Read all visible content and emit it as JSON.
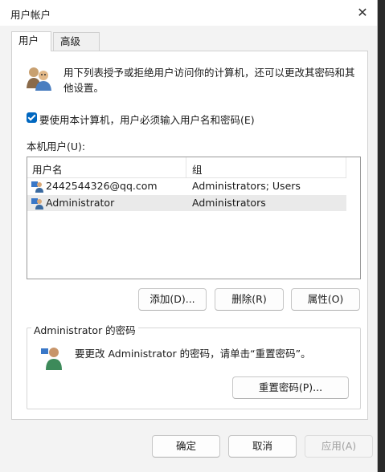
{
  "window": {
    "title": "用户帐户"
  },
  "tabs": [
    {
      "label": "用户"
    },
    {
      "label": "高级"
    }
  ],
  "intro": "用下列表授予或拒绝用户访问你的计算机，还可以更改其密码和其他设置。",
  "require_login": {
    "label": "要使用本计算机，用户必须输入用户名和密码(E)",
    "checked": true
  },
  "users_list": {
    "label": "本机用户(U):",
    "columns": [
      "用户名",
      "组"
    ],
    "rows": [
      {
        "name": "2442544326@qq.com",
        "group": "Administrators; Users",
        "selected": false
      },
      {
        "name": "Administrator",
        "group": "Administrators",
        "selected": true
      }
    ]
  },
  "list_buttons": {
    "add": "添加(D)...",
    "remove": "删除(R)",
    "properties": "属性(O)"
  },
  "password_group": {
    "title": "Administrator 的密码",
    "text": "要更改 Administrator 的密码，请单击“重置密码”。",
    "reset_button": "重置密码(P)..."
  },
  "dialog_buttons": {
    "ok": "确定",
    "cancel": "取消",
    "apply": "应用(A)"
  },
  "colors": {
    "accent": "#0067c0",
    "selection": "#eaeaea",
    "window_bg": "#f3f3f3"
  },
  "icons": [
    "users-icon",
    "user-icon",
    "user-admin-icon",
    "close-icon"
  ]
}
